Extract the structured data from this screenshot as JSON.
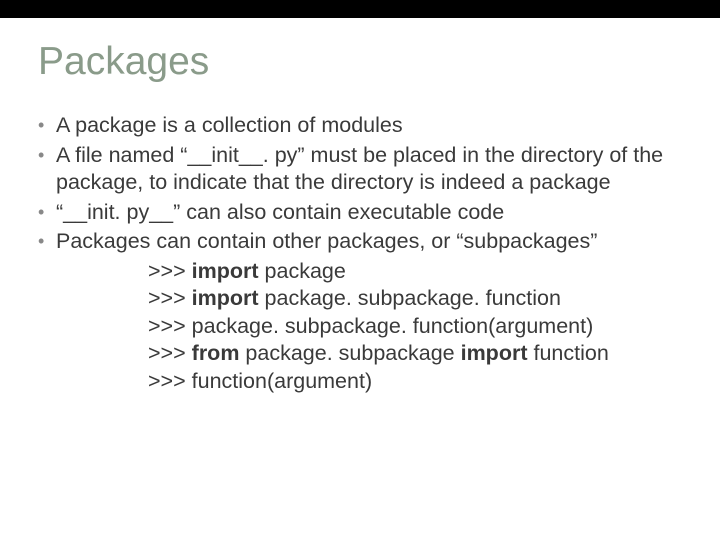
{
  "title": "Packages",
  "bullets": [
    "A package is a collection of modules",
    "A file named “__init__. py” must be placed in the directory of the package, to indicate that the directory is indeed a package",
    "“__init. py__” can also contain executable code",
    "Packages can contain other packages, or “subpackages”"
  ],
  "code": {
    "prompt": ">>>",
    "kw_import": "import",
    "kw_from": "from",
    "p": "package",
    "ps": "package. subpackage",
    "psf": "package. subpackage. function",
    "call": "package. subpackage. function(argument)",
    "fn": "function",
    "fncall": "function(argument)"
  }
}
